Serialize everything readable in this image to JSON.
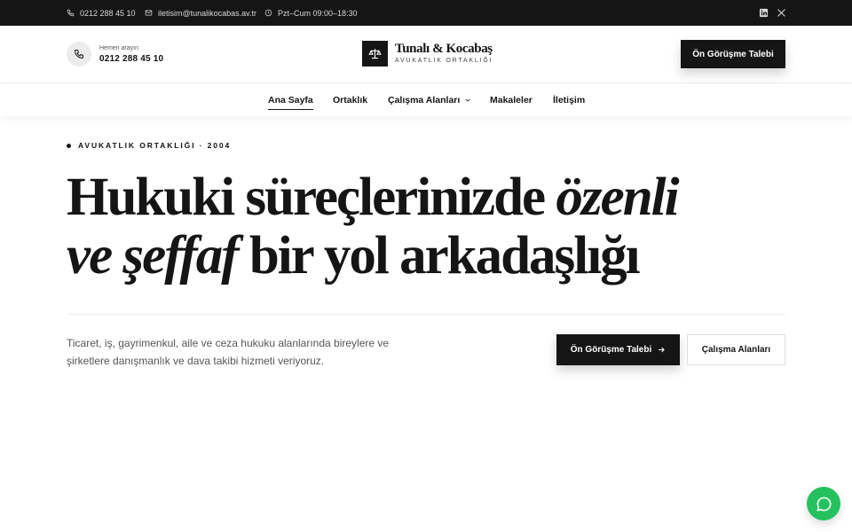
{
  "topbar": {
    "phone": "0212 288 45 10",
    "email": "iletisim@tunalikocabas.av.tr",
    "hours": "Pzt–Cum 09:00–18:30",
    "social": [
      "linkedin-icon",
      "x-icon"
    ]
  },
  "header": {
    "call_label": "Hemen arayın",
    "call_number": "0212 288 45 10",
    "logo_name": "Tunalı & Kocabaş",
    "logo_sub": "AVUKATLIK ORTAKLIĞI",
    "cta_label": "Ön Görüşme Talebi"
  },
  "nav": {
    "items": [
      {
        "label": "Ana Sayfa",
        "active": true
      },
      {
        "label": "Ortaklık"
      },
      {
        "label": "Çalışma Alanları",
        "dropdown": true
      },
      {
        "label": "Makaleler"
      },
      {
        "label": "İletişim"
      }
    ]
  },
  "hero": {
    "eyebrow": "AVUKATLIK ORTAKLIĞI · 2004",
    "headline_1": "Hukuki süreçlerinizde ",
    "headline_1_em": "özenli",
    "headline_2_em": "ve şeffaf",
    "headline_2": " bir yol arkadaşlığı",
    "lead": "Ticaret, iş, gayrimenkul, aile ve ceza hukuku alanlarında bireylere ve şirketlere danışmanlık ve dava takibi hizmeti veriyoruz.",
    "primary_label": "Ön Görüşme Talebi",
    "secondary_label": "Çalışma Alanları"
  },
  "colors": {
    "dark": "#151515",
    "chat": "#25c15f"
  }
}
